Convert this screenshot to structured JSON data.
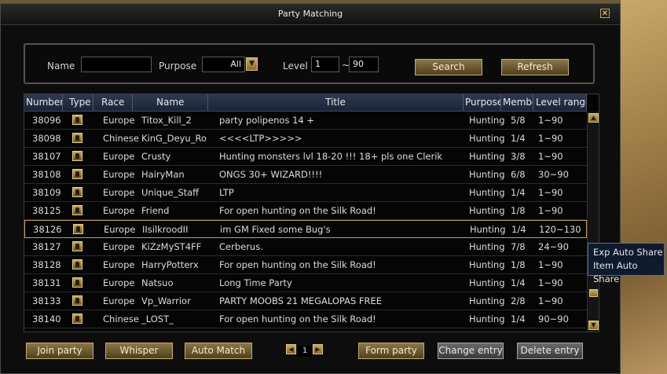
{
  "window": {
    "title": "Party Matching",
    "close_symbol": "✕"
  },
  "filter": {
    "name_label": "Name",
    "name_value": "",
    "purpose_label": "Purpose",
    "purpose_value": "All",
    "level_label": "Level",
    "level_min": "1",
    "level_sep": "~",
    "level_max": "90",
    "search_label": "Search",
    "refresh_label": "Refresh"
  },
  "columns": [
    "Number",
    "Type",
    "Race",
    "Name",
    "Title",
    "Purpose",
    "Membe",
    "Level range"
  ],
  "rows": [
    {
      "number": "38096",
      "race": "Europe",
      "name": "Titox_Kill_2",
      "title": "party polipenos 14 +",
      "purpose": "Hunting",
      "members": "5/8",
      "level": "1~90"
    },
    {
      "number": "38098",
      "race": "Chinese",
      "name": "KinG_Deyu_Ro",
      "title": "<<<<LTP>>>>>",
      "purpose": "Hunting",
      "members": "1/4",
      "level": "1~90"
    },
    {
      "number": "38107",
      "race": "Europe",
      "name": "Crusty",
      "title": "Hunting monsters lvl 18-20 !!! 18+ pls one Clerik",
      "purpose": "Hunting",
      "members": "3/8",
      "level": "1~90"
    },
    {
      "number": "38108",
      "race": "Europe",
      "name": "HairyMan",
      "title": "ONGS 30+ WIZARD!!!!",
      "purpose": "Hunting",
      "members": "6/8",
      "level": "30~90"
    },
    {
      "number": "38109",
      "race": "Europe",
      "name": "Unique_Staff",
      "title": "LTP",
      "purpose": "Hunting",
      "members": "1/4",
      "level": "1~90"
    },
    {
      "number": "38125",
      "race": "Europe",
      "name": "Friend",
      "title": "For open hunting on the Silk Road!",
      "purpose": "Hunting",
      "members": "1/8",
      "level": "1~90"
    },
    {
      "number": "38126",
      "race": "Europe",
      "name": "IIsilkroodII",
      "title": "im GM Fixed some Bug's",
      "purpose": "Hunting",
      "members": "1/4",
      "level": "120~130"
    },
    {
      "number": "38127",
      "race": "Europe",
      "name": "KiZzMyST4FF",
      "title": "Cerberus.",
      "purpose": "Hunting",
      "members": "7/8",
      "level": "24~90"
    },
    {
      "number": "38128",
      "race": "Europe",
      "name": "HarryPotterx",
      "title": "For open hunting on the Silk Road!",
      "purpose": "Hunting",
      "members": "1/8",
      "level": "1~90"
    },
    {
      "number": "38131",
      "race": "Europe",
      "name": "Natsuo",
      "title": "Long Time Party",
      "purpose": "Hunting",
      "members": "1/4",
      "level": "1~90"
    },
    {
      "number": "38133",
      "race": "Europe",
      "name": "Vp_Warrior",
      "title": "PARTY MOOBS 21 MEGALOPAS FREE",
      "purpose": "Hunting",
      "members": "2/8",
      "level": "1~90"
    },
    {
      "number": "38140",
      "race": "Chinese",
      "name": "_LOST_",
      "title": "For open hunting on the Silk Road!",
      "purpose": "Hunting",
      "members": "1/4",
      "level": "90~90"
    }
  ],
  "selected_row": 6,
  "tooltip": {
    "line1": "Exp Auto Share",
    "line2": "Item Auto Share"
  },
  "footer": {
    "join_label": "Join party",
    "whisper_label": "Whisper",
    "auto_match_label": "Auto Match",
    "page": "1",
    "form_label": "Form party",
    "change_label": "Change entry",
    "delete_label": "Delete entry"
  },
  "colors": {
    "accent_gold": "#c9ad6c",
    "header_blue": "#2d3a52",
    "selection": "#c49a6a"
  }
}
